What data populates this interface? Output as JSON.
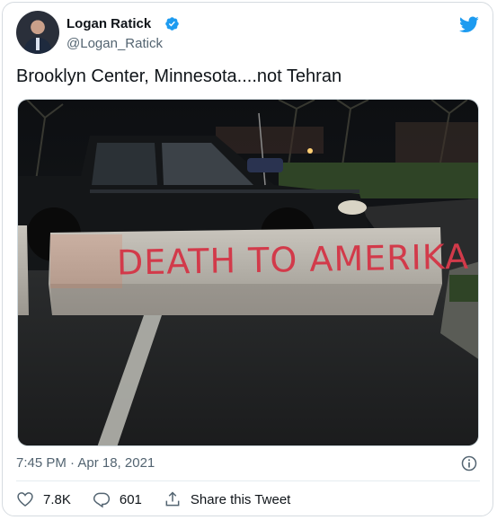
{
  "tweet": {
    "author_name": "Logan Ratick",
    "author_handle": "@Logan_Ratick",
    "verified": true,
    "text": "Brooklyn Center, Minnesota....not Tehran",
    "timestamp": "7:45 PM · Apr 18, 2021",
    "image_text": "DEATH TO AMERIKA"
  },
  "actions": {
    "likes": "7.8K",
    "replies": "601",
    "share_label": "Share this Tweet"
  },
  "colors": {
    "twitter_blue": "#1d9bf0",
    "text_primary": "#0f1419",
    "text_secondary": "#536471",
    "spray_paint": "#d23a4a"
  },
  "icons": [
    "verified-badge-icon",
    "twitter-bird-icon",
    "info-icon",
    "heart-icon",
    "reply-icon",
    "share-icon"
  ]
}
